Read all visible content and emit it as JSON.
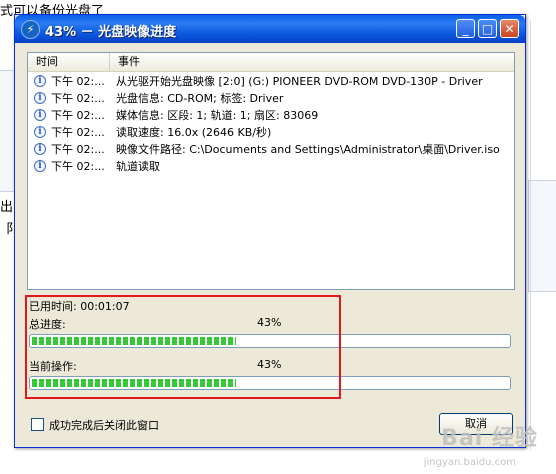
{
  "background": {
    "top_text": "式可以备份光盘了",
    "left_text_1": "出自",
    "left_text_2": "阝"
  },
  "window": {
    "title": "43% － 光盘映像进度",
    "accent": "#0a5fe8"
  },
  "list": {
    "columns": [
      "时间",
      "事件"
    ],
    "rows": [
      {
        "time": "下午 02:...",
        "event": "从光驱开始光盘映像 [2:0] (G:) PIONEER DVD-ROM DVD-130P -   Driver"
      },
      {
        "time": "下午 02:...",
        "event": "光盘信息: CD-ROM; 标签:  Driver"
      },
      {
        "time": "下午 02:...",
        "event": "媒体信息: 区段: 1; 轨道: 1; 扇区: 83069"
      },
      {
        "time": "下午 02:...",
        "event": "读取速度: 16.0x (2646 KB/秒)"
      },
      {
        "time": "下午 02:...",
        "event": "映像文件路径: C:\\Documents and Settings\\Administrator\\桌面\\Driver.iso"
      },
      {
        "time": "下午 02:...",
        "event": "轨道读取"
      }
    ]
  },
  "progress": {
    "elapsed_label": "已用时间: 00:01:07",
    "total_label": "总进度:",
    "total_percent": "43%",
    "total_value": 0.43,
    "current_label": "当前操作:",
    "current_percent": "43%",
    "current_value": 0.43,
    "bar_color": "#37c837"
  },
  "footer": {
    "checkbox_label": "成功完成后关闭此窗口",
    "checkbox_checked": false,
    "cancel_label": "取消"
  },
  "watermark": {
    "text": "Bai 经验",
    "sub": "jingyan.baidu.com"
  }
}
